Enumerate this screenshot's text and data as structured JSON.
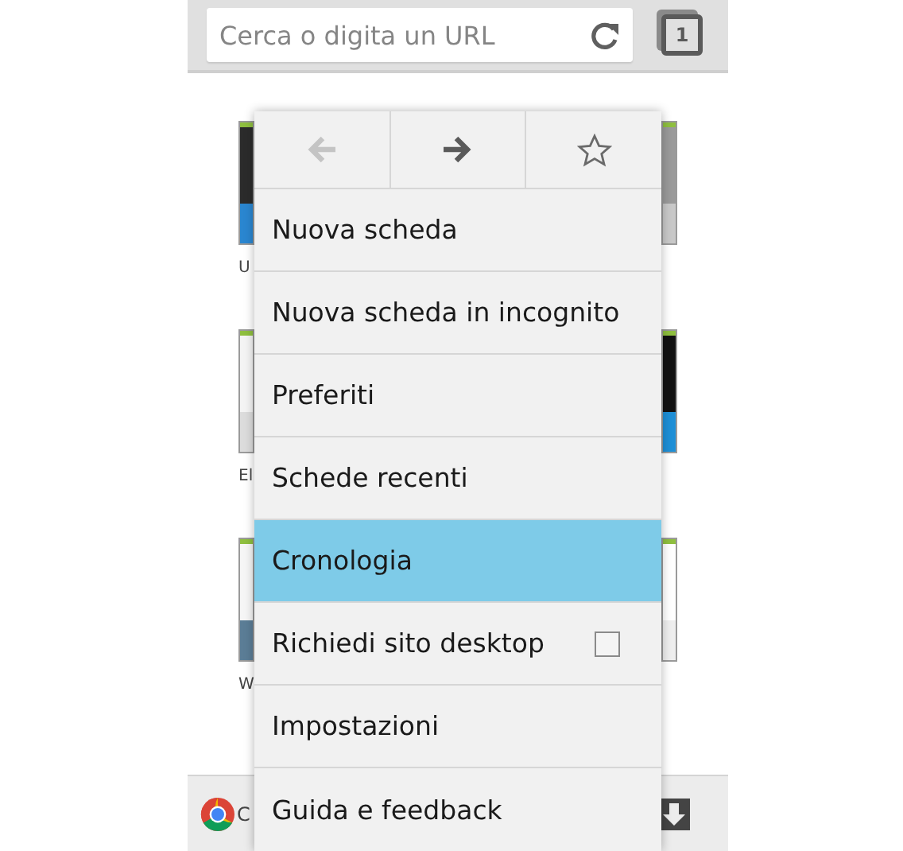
{
  "toolbar": {
    "url_placeholder": "Cerca o digita un URL",
    "tab_count": "1"
  },
  "thumbnail_rows": [
    {
      "label": "U"
    },
    {
      "label": "El"
    },
    {
      "label": "W"
    }
  ],
  "bottom_bar": {
    "text": "C"
  },
  "menu": {
    "nav": [
      {
        "kind": "back",
        "disabled": true
      },
      {
        "kind": "forward",
        "disabled": false
      },
      {
        "kind": "bookmark",
        "disabled": false
      }
    ],
    "items": [
      {
        "label": "Nuova scheda",
        "kind": "plain",
        "selected": false
      },
      {
        "label": "Nuova scheda in incognito",
        "kind": "plain",
        "selected": false
      },
      {
        "label": "Preferiti",
        "kind": "plain",
        "selected": false
      },
      {
        "label": "Schede recenti",
        "kind": "plain",
        "selected": false
      },
      {
        "label": "Cronologia",
        "kind": "plain",
        "selected": true
      },
      {
        "label": "Richiedi sito desktop",
        "kind": "checkbox",
        "selected": false,
        "checked": false
      },
      {
        "label": "Impostazioni",
        "kind": "plain",
        "selected": false
      },
      {
        "label": "Guida e feedback",
        "kind": "plain",
        "selected": false
      }
    ]
  }
}
